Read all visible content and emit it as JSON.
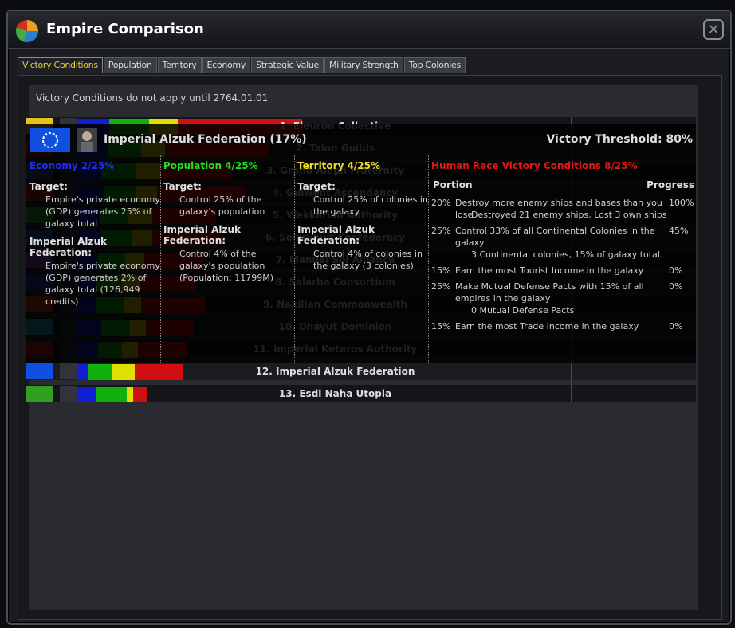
{
  "window": {
    "title": "Empire Comparison",
    "close_glyph": "✕"
  },
  "tabs": [
    "Victory Conditions",
    "Population",
    "Territory",
    "Economy",
    "Strategic Value",
    "Military Strength",
    "Top Colonies"
  ],
  "notice": "Victory Conditions do not apply until 2764.01.01",
  "rankings": [
    {
      "label": "1. Eleuron Collective",
      "flag": "#e8c020",
      "bars": [
        {
          "c": "#1020d0",
          "w": 40
        },
        {
          "c": "#10b010",
          "w": 50
        },
        {
          "c": "#e0e000",
          "w": 36
        },
        {
          "c": "#d01010",
          "w": 156
        }
      ]
    },
    {
      "label": "2. Talon Guilds",
      "flag": "#c02020",
      "bars": [
        {
          "c": "#1020d0",
          "w": 38
        },
        {
          "c": "#10b010",
          "w": 42
        },
        {
          "c": "#e0e000",
          "w": 30
        },
        {
          "c": "#d01010",
          "w": 130
        }
      ]
    },
    {
      "label": "3. Grand Aleph Fraternity",
      "flag": "#3050a0",
      "bars": [
        {
          "c": "#1020d0",
          "w": 30
        },
        {
          "c": "#10b010",
          "w": 44
        },
        {
          "c": "#e0e000",
          "w": 30
        },
        {
          "c": "#d01010",
          "w": 90
        }
      ]
    },
    {
      "label": "4. Gulwent Ascendancy",
      "flag": "#b02020",
      "bars": [
        {
          "c": "#1020d0",
          "w": 34
        },
        {
          "c": "#10b010",
          "w": 40
        },
        {
          "c": "#e0e000",
          "w": 26
        },
        {
          "c": "#d01010",
          "w": 110
        }
      ]
    },
    {
      "label": "5. Wekkarian Authority",
      "flag": "#30a030",
      "bars": [
        {
          "c": "#1020d0",
          "w": 28
        },
        {
          "c": "#10b010",
          "w": 36
        },
        {
          "c": "#e0e000",
          "w": 30
        },
        {
          "c": "#d01010",
          "w": 80
        }
      ]
    },
    {
      "label": "6. Solarvault Confederacy",
      "flag": "#2060c0",
      "bars": [
        {
          "c": "#1020d0",
          "w": 30
        },
        {
          "c": "#10b010",
          "w": 38
        },
        {
          "c": "#e0e000",
          "w": 26
        },
        {
          "c": "#d01010",
          "w": 86
        }
      ]
    },
    {
      "label": "7. Manuel Sol Alliance",
      "flag": "#8040c0",
      "bars": [
        {
          "c": "#1020d0",
          "w": 26
        },
        {
          "c": "#10b010",
          "w": 34
        },
        {
          "c": "#e0e000",
          "w": 24
        },
        {
          "c": "#d01010",
          "w": 74
        }
      ]
    },
    {
      "label": "8. Salarba Consortium",
      "flag": "#2040b0",
      "bars": [
        {
          "c": "#1020d0",
          "w": 24
        },
        {
          "c": "#10b010",
          "w": 32
        },
        {
          "c": "#e0e000",
          "w": 22
        },
        {
          "c": "#d01010",
          "w": 70
        }
      ]
    },
    {
      "label": "9. Nakilian Commonwealth",
      "flag": "#c04010",
      "bars": [
        {
          "c": "#1020d0",
          "w": 24
        },
        {
          "c": "#10b010",
          "w": 34
        },
        {
          "c": "#e0e000",
          "w": 22
        },
        {
          "c": "#d01010",
          "w": 80
        }
      ]
    },
    {
      "label": "10. Dhayut Dominion",
      "flag": "#20a0c0",
      "bars": [
        {
          "c": "#1020d0",
          "w": 30
        },
        {
          "c": "#10b010",
          "w": 36
        },
        {
          "c": "#e0e000",
          "w": 20
        },
        {
          "c": "#d01010",
          "w": 60
        }
      ]
    },
    {
      "label": "11. Imperial Ketaros Authority",
      "flag": "#c02020",
      "bars": [
        {
          "c": "#1020d0",
          "w": 26
        },
        {
          "c": "#10b010",
          "w": 30
        },
        {
          "c": "#e0e000",
          "w": 20
        },
        {
          "c": "#d01010",
          "w": 62
        }
      ]
    },
    {
      "label": "12. Imperial Alzuk Federation",
      "flag": "#1050e0",
      "bars": [
        {
          "c": "#1020d0",
          "w": 14
        },
        {
          "c": "#10b010",
          "w": 30
        },
        {
          "c": "#e0e000",
          "w": 28
        },
        {
          "c": "#d01010",
          "w": 60
        }
      ]
    },
    {
      "label": "13. Esdi Naha Utopia",
      "flag": "#30a020",
      "bars": [
        {
          "c": "#1020d0",
          "w": 24
        },
        {
          "c": "#10b010",
          "w": 38
        },
        {
          "c": "#e0e000",
          "w": 8
        },
        {
          "c": "#d01010",
          "w": 18
        }
      ]
    }
  ],
  "selected": {
    "name": "Imperial Alzuk Federation",
    "pct": "(17%)",
    "threshold": "Victory Threshold: 80%"
  },
  "economy": {
    "head": "Economy  2/25%",
    "target_label": "Target:",
    "target_text": "Empire's private economy (GDP) generates 25% of galaxy total",
    "empire_label": "Imperial Alzuk Federation:",
    "empire_text": "Empire's private economy (GDP) generates 2% of galaxy total (126,949 credits)"
  },
  "population": {
    "head": "Population  4/25%",
    "target_label": "Target:",
    "target_text": "Control 25% of the galaxy's population",
    "empire_label": "Imperial Alzuk Federation:",
    "empire_text": "Control 4% of the galaxy's population (Population: 11799M)"
  },
  "territory": {
    "head": "Territory  4/25%",
    "target_label": "Target:",
    "target_text": "Control 25% of colonies in the galaxy",
    "empire_label": "Imperial Alzuk Federation:",
    "empire_text": "Control 4% of colonies in the galaxy (3 colonies)"
  },
  "race": {
    "head": "Human Race Victory Conditions  8/25%",
    "portion": "Portion",
    "progress": "Progress",
    "items": [
      {
        "p": "20%",
        "d": "Destroy more enemy ships and bases than you lose",
        "sub": "Destroyed 21 enemy ships, Lost 3 own ships",
        "pr": "100%"
      },
      {
        "p": "25%",
        "d": "Control 33% of all Continental Colonies in the galaxy",
        "sub": "3 Continental colonies, 15% of galaxy total",
        "pr": "45%"
      },
      {
        "p": "15%",
        "d": "Earn the most Tourist Income in the galaxy",
        "sub": "",
        "pr": "0%"
      },
      {
        "p": "25%",
        "d": "Make Mutual Defense Pacts with 15% of all empires in the galaxy",
        "sub": "0 Mutual Defense Pacts",
        "pr": "0%"
      },
      {
        "p": "15%",
        "d": "Earn the most Trade Income in the galaxy",
        "sub": "",
        "pr": "0%"
      }
    ]
  },
  "colors": {
    "economy": "#1a2ff0",
    "population": "#20e020",
    "territory": "#f0e020",
    "race": "#e01818",
    "active_tab": "#e8d23a"
  }
}
